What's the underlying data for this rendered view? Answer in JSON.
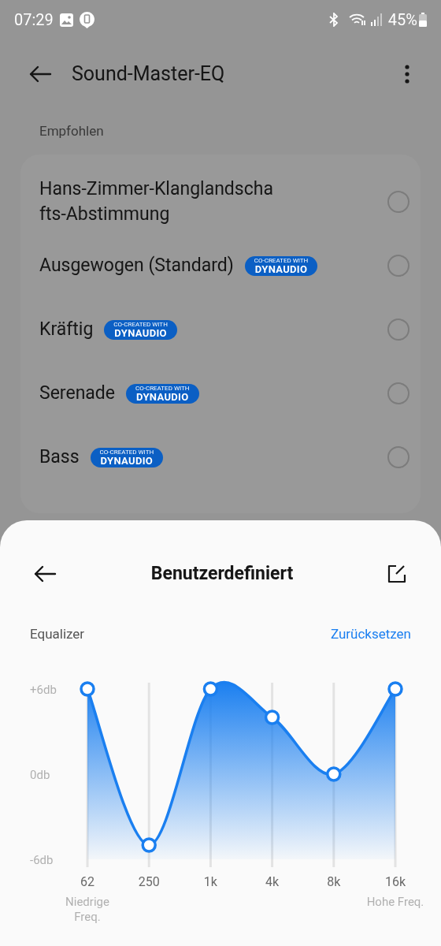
{
  "status_bar": {
    "time": "07:29",
    "battery": "45%"
  },
  "header": {
    "title": "Sound-Master-EQ"
  },
  "presets": {
    "heading": "Empfohlen",
    "items": [
      {
        "name": "Hans-Zimmer-Klanglandschafts-Abstimmung",
        "selected": false
      },
      {
        "name": "Ausgewogen (Standard)",
        "badge": [
          "CO-CREATED WITH",
          "DYNAUDIO"
        ],
        "selected": false
      },
      {
        "name": "Kräftig",
        "badge": [
          "CO-CREATED WITH",
          "DYNAUDIO"
        ],
        "selected": false
      },
      {
        "name": "Serenade",
        "badge": [
          "CO-CREATED WITH",
          "DYNAUDIO"
        ],
        "selected": false
      },
      {
        "name": "Bass",
        "badge": [
          "CO-CREATED WITH",
          "DYNAUDIO"
        ],
        "selected": false
      }
    ]
  },
  "sheet": {
    "title": "Benutzerdefiniert",
    "reset": "Zurücksetzen",
    "low_label": [
      "Niedrige",
      "Freq."
    ],
    "high_label": "Hohe Freq.",
    "chart_data": {
      "type": "line",
      "grid": true,
      "categories": [
        "62",
        "250",
        "1k",
        "4k",
        "8k",
        "16k"
      ],
      "series": [
        {
          "name": "Equalizer",
          "color": "#1a7ff0",
          "marker": "circle",
          "values": [
            6,
            -5,
            6,
            4,
            0,
            6
          ]
        }
      ],
      "ylim": [
        -6,
        6
      ],
      "yticks": [
        {
          "value": 6,
          "label": "+6db"
        },
        {
          "value": 0,
          "label": "0db"
        },
        {
          "value": -6,
          "label": "-6db"
        }
      ]
    }
  }
}
